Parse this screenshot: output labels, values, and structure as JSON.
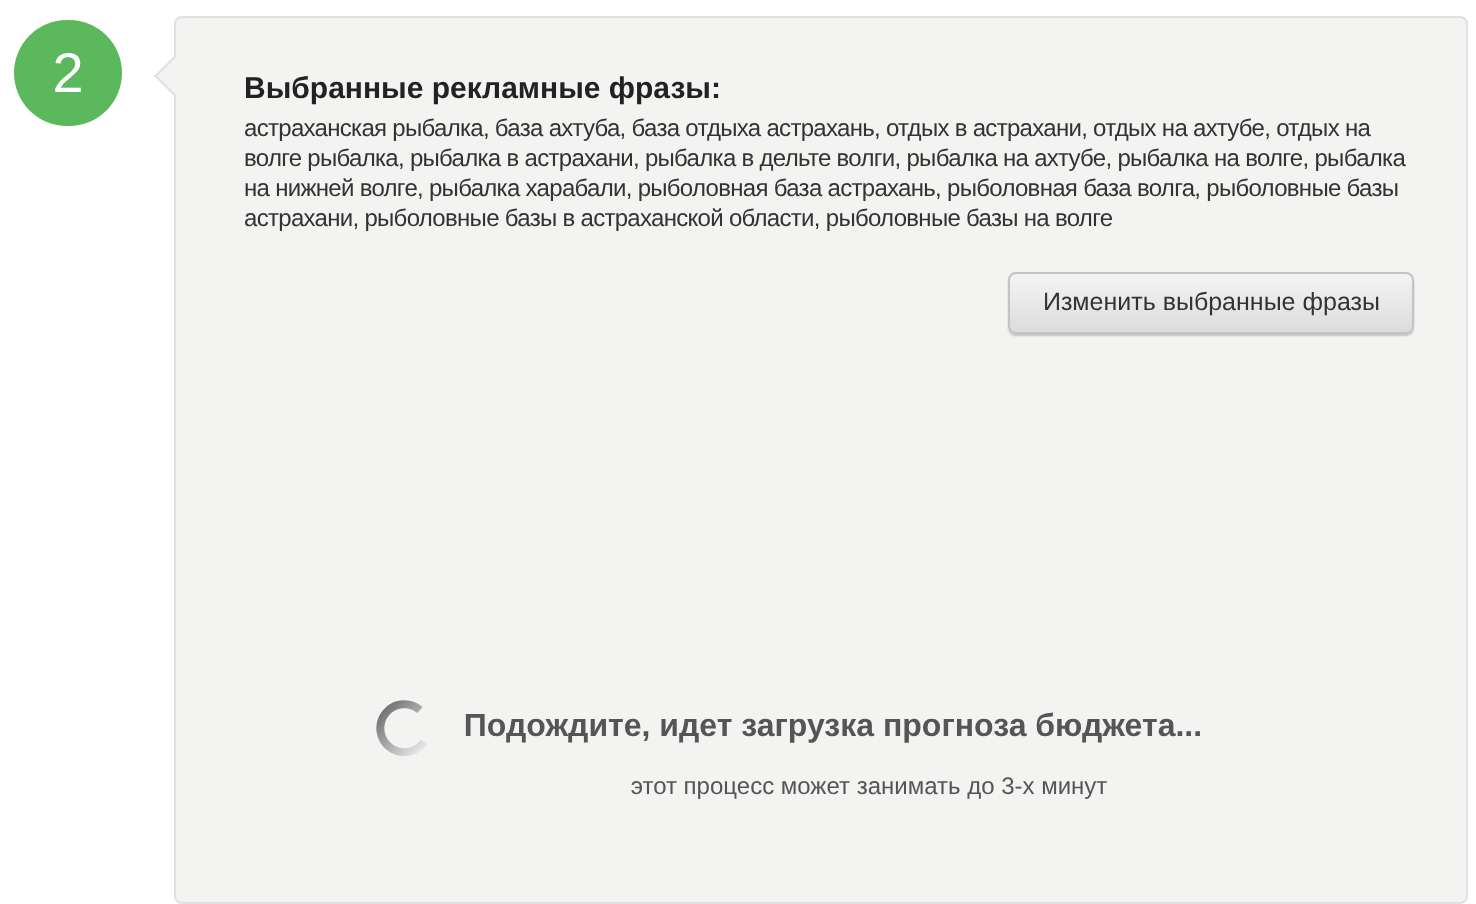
{
  "step": {
    "number": "2"
  },
  "phrases": {
    "title": "Выбранные рекламные фразы:",
    "text": "астраханская рыбалка, база ахтуба, база отдыха астрахань, отдых в астрахани, отдых на ахтубе, отдых на волге рыбалка, рыбалка в астрахани, рыбалка в дельте волги, рыбалка на ахтубе, рыбалка на волге, рыбалка на нижней волге, рыбалка харабали, рыболовная база астрахань, рыболовная база волга, рыболовные базы астрахани, рыболовные базы в астраханской области, рыболовные базы на волге"
  },
  "buttons": [
    "Изменить выбранные фразы"
  ],
  "loading": {
    "message": "Подождите, идет загрузка прогноза бюджета...",
    "note": "этот процесс может занимать до 3-х минут"
  }
}
